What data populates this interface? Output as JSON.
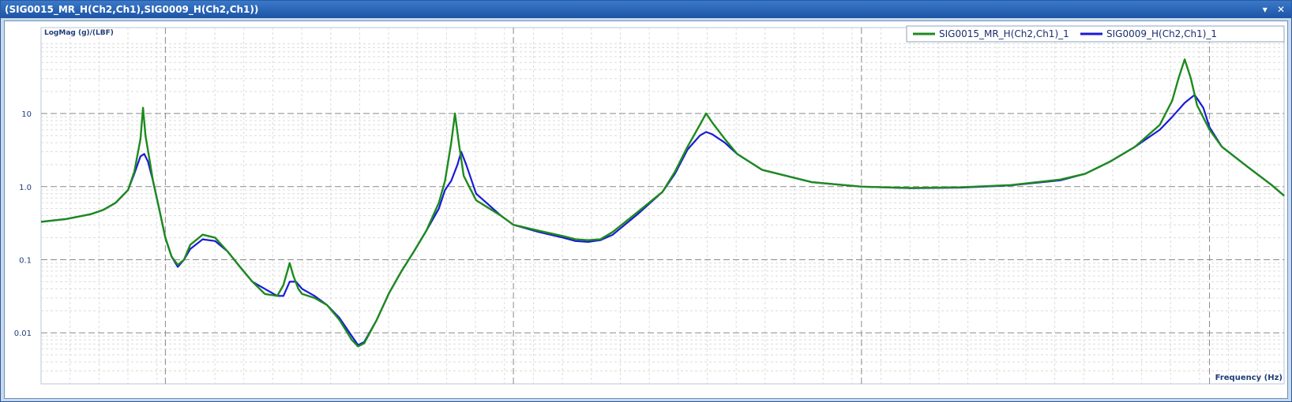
{
  "window": {
    "title": "(SIG0015_MR_H(Ch2,Ch1),SIG0009_H(Ch2,Ch1))",
    "pin_glyph": "▾",
    "close_glyph": "✕"
  },
  "chart_data": {
    "type": "line",
    "ylabel": "LogMag (g)/(LBF)",
    "xlabel": "Frequency (Hz)",
    "yscale": "log",
    "ylim": [
      0.002,
      150
    ],
    "xlim": [
      0,
      1
    ],
    "ytick_labels": [
      {
        "value": 10,
        "label": "10"
      },
      {
        "value": 1,
        "label": "1.0"
      },
      {
        "value": 0.1,
        "label": "0.1"
      },
      {
        "value": 0.01,
        "label": "0.01"
      }
    ],
    "x_major_grid": [
      0.1,
      0.38,
      0.66,
      0.94
    ],
    "x_minor_step": 0.0233,
    "grid": true,
    "legend_position": "top-right",
    "colors": {
      "green": "#1e8a1e",
      "blue": "#1a1ad8"
    },
    "series": [
      {
        "name": "SIG0015_MR_H(Ch2,Ch1)_1",
        "color": "#1e8a1e",
        "points": [
          [
            0.0,
            0.33
          ],
          [
            0.02,
            0.36
          ],
          [
            0.04,
            0.42
          ],
          [
            0.05,
            0.48
          ],
          [
            0.06,
            0.6
          ],
          [
            0.07,
            0.9
          ],
          [
            0.075,
            1.6
          ],
          [
            0.08,
            4.5
          ],
          [
            0.082,
            12
          ],
          [
            0.084,
            5
          ],
          [
            0.087,
            2.5
          ],
          [
            0.09,
            1.2
          ],
          [
            0.095,
            0.5
          ],
          [
            0.1,
            0.2
          ],
          [
            0.105,
            0.11
          ],
          [
            0.11,
            0.085
          ],
          [
            0.115,
            0.1
          ],
          [
            0.12,
            0.16
          ],
          [
            0.13,
            0.22
          ],
          [
            0.14,
            0.2
          ],
          [
            0.15,
            0.13
          ],
          [
            0.16,
            0.08
          ],
          [
            0.17,
            0.05
          ],
          [
            0.18,
            0.034
          ],
          [
            0.19,
            0.032
          ],
          [
            0.195,
            0.045
          ],
          [
            0.2,
            0.09
          ],
          [
            0.203,
            0.06
          ],
          [
            0.207,
            0.04
          ],
          [
            0.21,
            0.034
          ],
          [
            0.22,
            0.03
          ],
          [
            0.23,
            0.024
          ],
          [
            0.24,
            0.015
          ],
          [
            0.25,
            0.008
          ],
          [
            0.255,
            0.0065
          ],
          [
            0.26,
            0.0072
          ],
          [
            0.27,
            0.015
          ],
          [
            0.28,
            0.035
          ],
          [
            0.29,
            0.07
          ],
          [
            0.3,
            0.13
          ],
          [
            0.31,
            0.25
          ],
          [
            0.32,
            0.6
          ],
          [
            0.325,
            1.2
          ],
          [
            0.33,
            4
          ],
          [
            0.333,
            10
          ],
          [
            0.336,
            4
          ],
          [
            0.34,
            1.4
          ],
          [
            0.35,
            0.65
          ],
          [
            0.37,
            0.4
          ],
          [
            0.38,
            0.3
          ],
          [
            0.4,
            0.25
          ],
          [
            0.42,
            0.21
          ],
          [
            0.43,
            0.19
          ],
          [
            0.44,
            0.185
          ],
          [
            0.45,
            0.19
          ],
          [
            0.46,
            0.24
          ],
          [
            0.48,
            0.45
          ],
          [
            0.5,
            0.85
          ],
          [
            0.51,
            1.6
          ],
          [
            0.52,
            3.5
          ],
          [
            0.53,
            7
          ],
          [
            0.535,
            10
          ],
          [
            0.54,
            7.5
          ],
          [
            0.55,
            4.5
          ],
          [
            0.56,
            2.8
          ],
          [
            0.58,
            1.7
          ],
          [
            0.62,
            1.15
          ],
          [
            0.66,
            1.0
          ],
          [
            0.7,
            0.96
          ],
          [
            0.74,
            0.98
          ],
          [
            0.78,
            1.05
          ],
          [
            0.82,
            1.25
          ],
          [
            0.84,
            1.5
          ],
          [
            0.86,
            2.2
          ],
          [
            0.88,
            3.5
          ],
          [
            0.9,
            7
          ],
          [
            0.91,
            15
          ],
          [
            0.915,
            30
          ],
          [
            0.92,
            55
          ],
          [
            0.925,
            30
          ],
          [
            0.93,
            13
          ],
          [
            0.94,
            6
          ],
          [
            0.95,
            3.5
          ],
          [
            0.97,
            1.9
          ],
          [
            0.99,
            1.05
          ],
          [
            1.0,
            0.75
          ]
        ]
      },
      {
        "name": "SIG0009_H(Ch2,Ch1)_1",
        "color": "#1a1ad8",
        "points": [
          [
            0.0,
            0.33
          ],
          [
            0.02,
            0.36
          ],
          [
            0.04,
            0.42
          ],
          [
            0.05,
            0.48
          ],
          [
            0.06,
            0.6
          ],
          [
            0.07,
            0.9
          ],
          [
            0.075,
            1.5
          ],
          [
            0.08,
            2.6
          ],
          [
            0.083,
            2.8
          ],
          [
            0.086,
            2.2
          ],
          [
            0.09,
            1.2
          ],
          [
            0.095,
            0.5
          ],
          [
            0.1,
            0.2
          ],
          [
            0.105,
            0.11
          ],
          [
            0.11,
            0.08
          ],
          [
            0.115,
            0.1
          ],
          [
            0.12,
            0.14
          ],
          [
            0.13,
            0.19
          ],
          [
            0.14,
            0.18
          ],
          [
            0.15,
            0.13
          ],
          [
            0.16,
            0.08
          ],
          [
            0.17,
            0.05
          ],
          [
            0.18,
            0.04
          ],
          [
            0.19,
            0.032
          ],
          [
            0.195,
            0.032
          ],
          [
            0.2,
            0.05
          ],
          [
            0.205,
            0.05
          ],
          [
            0.21,
            0.04
          ],
          [
            0.22,
            0.032
          ],
          [
            0.23,
            0.024
          ],
          [
            0.24,
            0.016
          ],
          [
            0.25,
            0.009
          ],
          [
            0.255,
            0.0068
          ],
          [
            0.26,
            0.0075
          ],
          [
            0.27,
            0.015
          ],
          [
            0.28,
            0.035
          ],
          [
            0.29,
            0.07
          ],
          [
            0.3,
            0.13
          ],
          [
            0.31,
            0.25
          ],
          [
            0.32,
            0.5
          ],
          [
            0.325,
            0.9
          ],
          [
            0.33,
            1.2
          ],
          [
            0.335,
            2
          ],
          [
            0.338,
            3
          ],
          [
            0.342,
            2
          ],
          [
            0.35,
            0.8
          ],
          [
            0.37,
            0.4
          ],
          [
            0.38,
            0.3
          ],
          [
            0.4,
            0.24
          ],
          [
            0.42,
            0.2
          ],
          [
            0.43,
            0.18
          ],
          [
            0.44,
            0.175
          ],
          [
            0.45,
            0.185
          ],
          [
            0.46,
            0.22
          ],
          [
            0.48,
            0.42
          ],
          [
            0.5,
            0.85
          ],
          [
            0.51,
            1.5
          ],
          [
            0.52,
            3.2
          ],
          [
            0.53,
            5
          ],
          [
            0.535,
            5.6
          ],
          [
            0.54,
            5.2
          ],
          [
            0.55,
            4
          ],
          [
            0.56,
            2.8
          ],
          [
            0.58,
            1.7
          ],
          [
            0.62,
            1.15
          ],
          [
            0.66,
            1.0
          ],
          [
            0.7,
            0.95
          ],
          [
            0.74,
            0.97
          ],
          [
            0.78,
            1.04
          ],
          [
            0.82,
            1.22
          ],
          [
            0.84,
            1.5
          ],
          [
            0.86,
            2.2
          ],
          [
            0.88,
            3.5
          ],
          [
            0.9,
            6
          ],
          [
            0.91,
            9
          ],
          [
            0.92,
            14
          ],
          [
            0.928,
            18
          ],
          [
            0.935,
            12
          ],
          [
            0.94,
            6.5
          ],
          [
            0.95,
            3.5
          ],
          [
            0.97,
            1.9
          ],
          [
            0.99,
            1.05
          ],
          [
            1.0,
            0.75
          ]
        ]
      }
    ]
  }
}
